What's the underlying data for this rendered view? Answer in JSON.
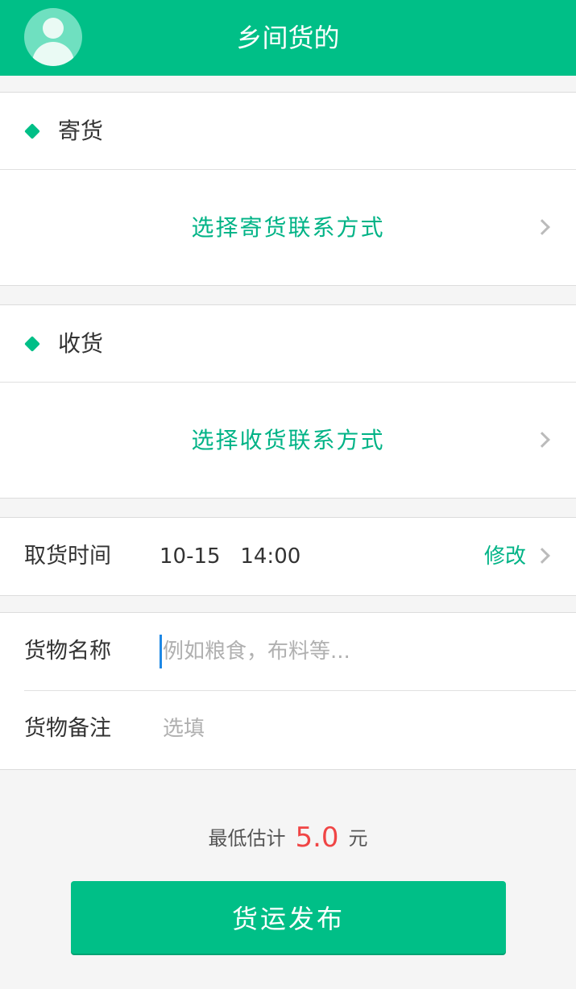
{
  "header": {
    "title": "乡间货的",
    "avatar_icon": "user-avatar-icon"
  },
  "sender": {
    "title": "寄货",
    "select_text": "选择寄货联系方式"
  },
  "receiver": {
    "title": "收货",
    "select_text": "选择收货联系方式"
  },
  "pickup": {
    "label": "取货时间",
    "value": "10-15   14:00",
    "edit_label": "修改"
  },
  "goods": {
    "name_label": "货物名称",
    "name_placeholder": "例如粮食，布料等...",
    "name_value": "",
    "note_label": "货物备注",
    "note_placeholder": "选填",
    "note_value": ""
  },
  "estimate": {
    "prefix": "最低估计",
    "price": "5.0",
    "unit": "元"
  },
  "publish_button": {
    "label": "货运发布"
  },
  "colors": {
    "accent": "#00bf87",
    "accent_text": "#00b386",
    "price": "#f04545",
    "caret": "#1e88e5"
  }
}
